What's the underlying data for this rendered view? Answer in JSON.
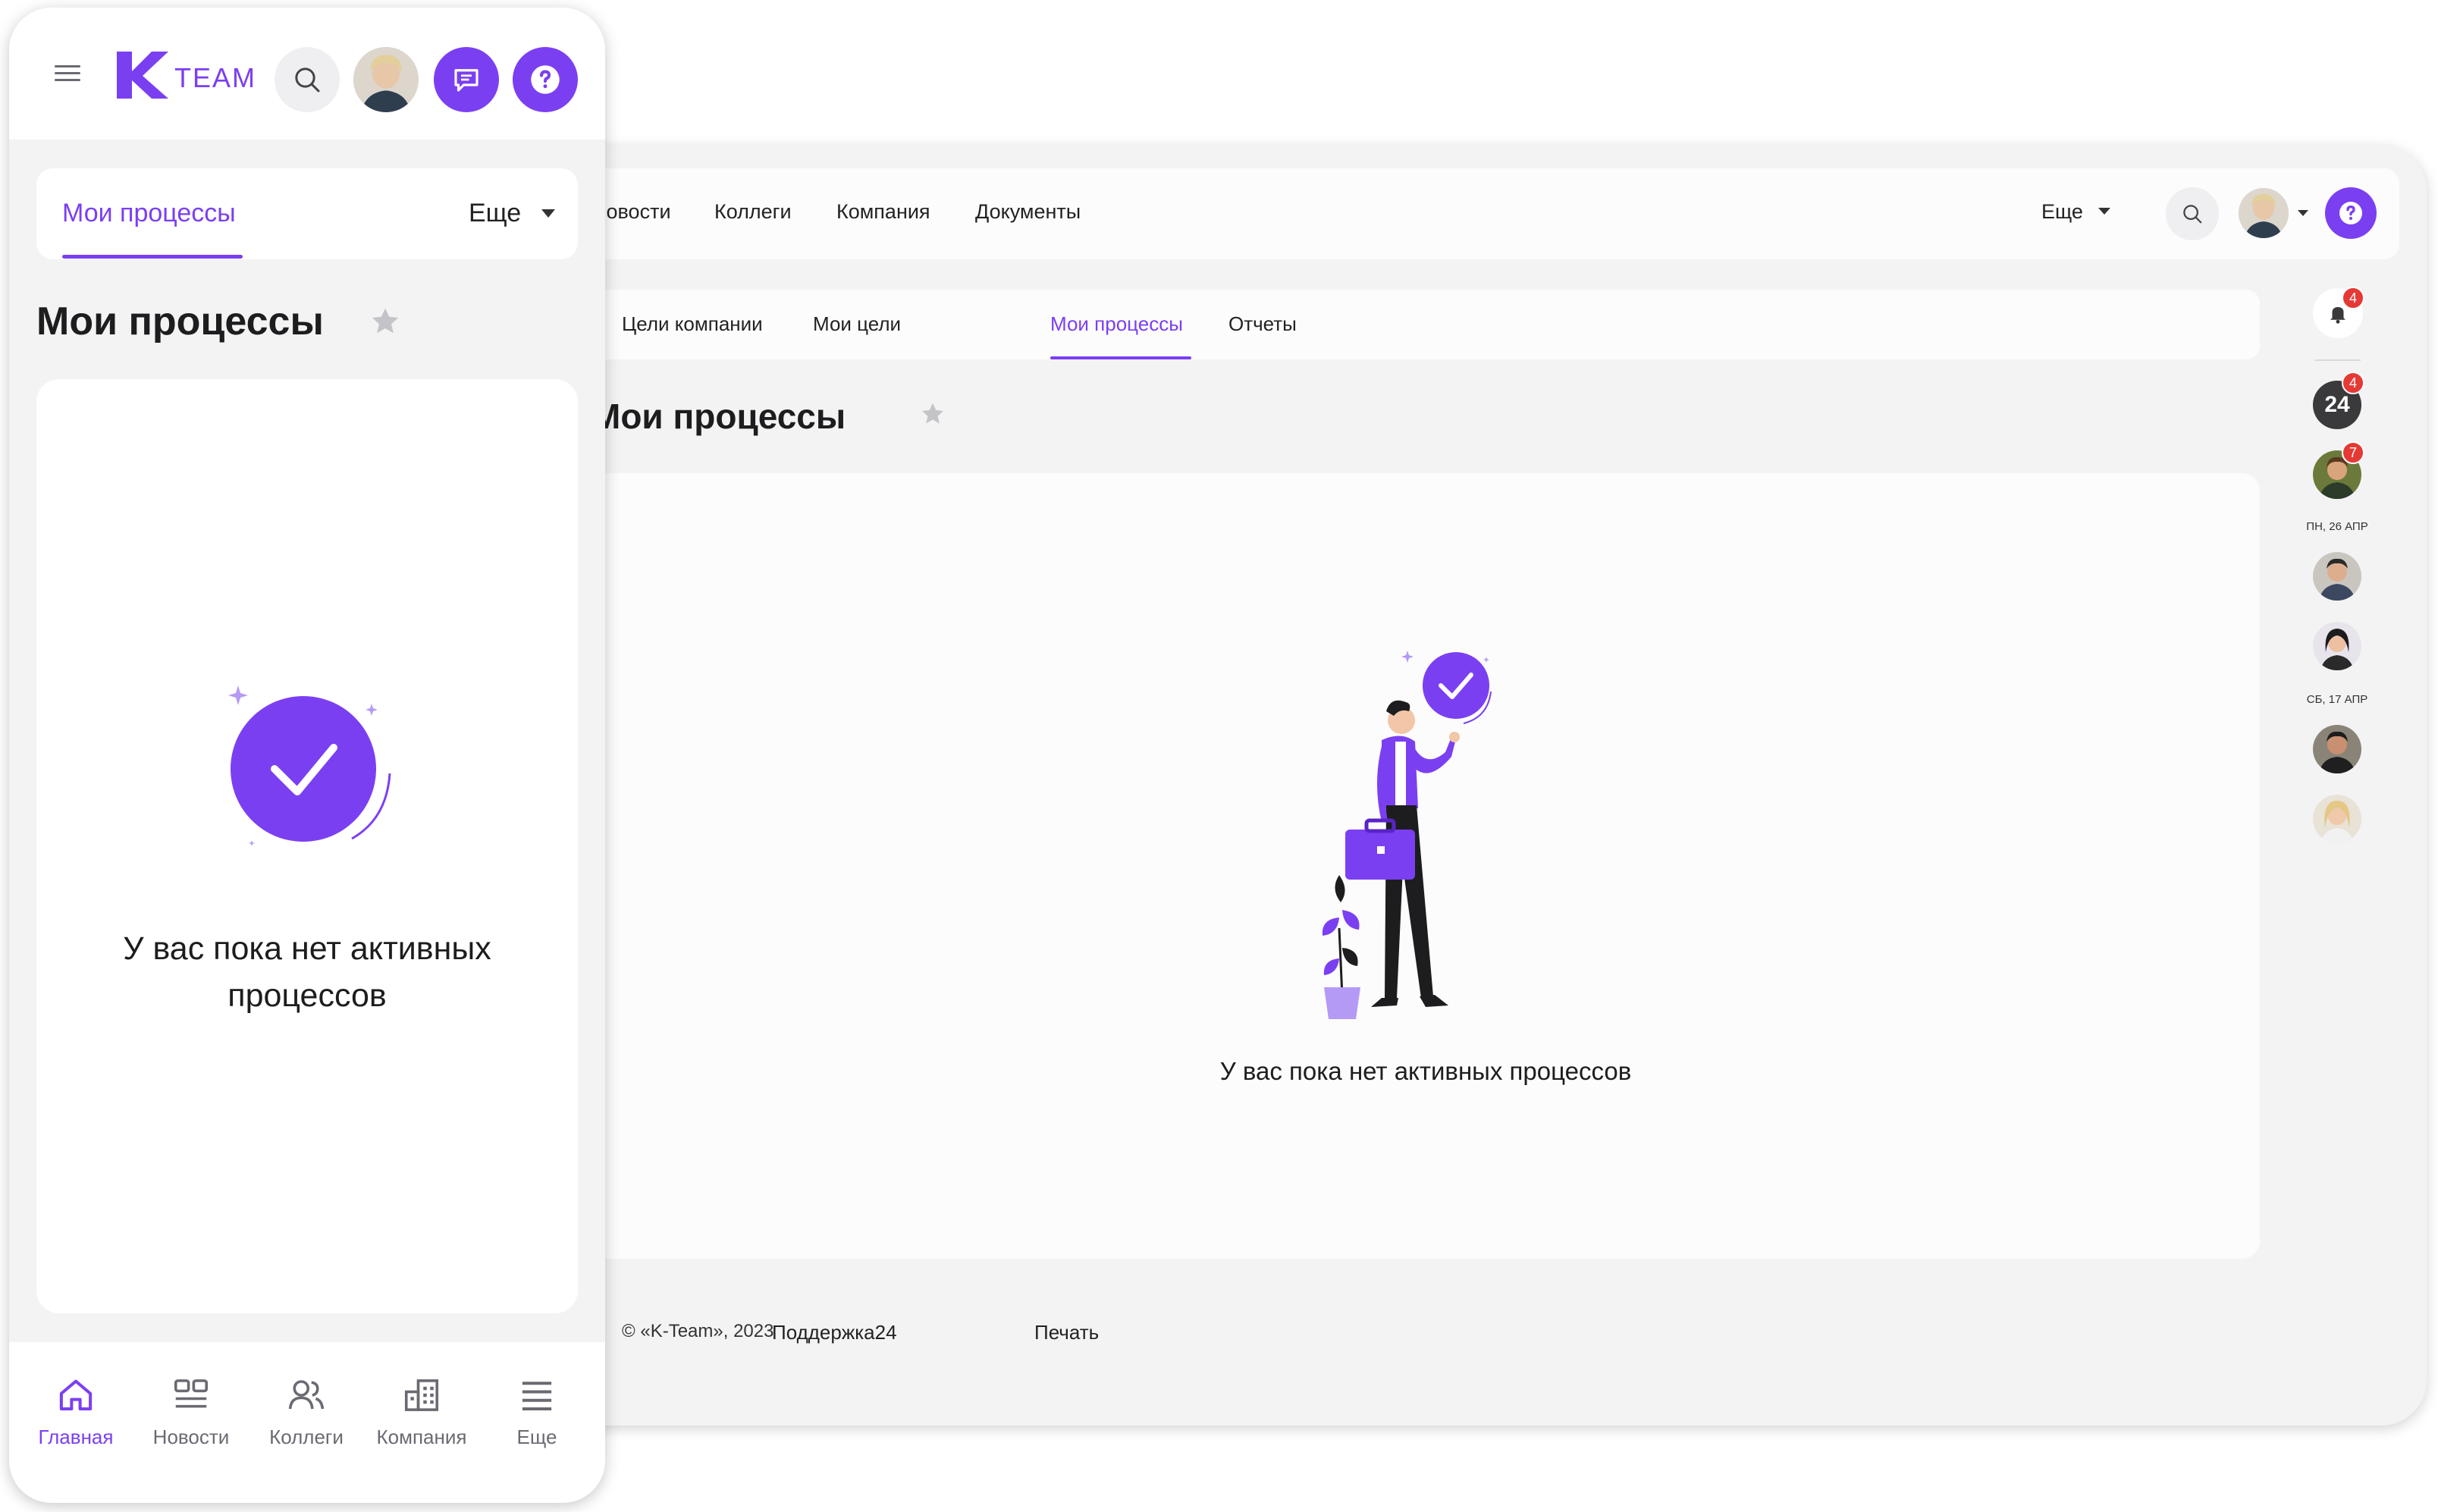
{
  "desktop": {
    "nav": [
      "Новости",
      "Коллеги",
      "Компания",
      "Документы"
    ],
    "more_label": "Еще",
    "tabs": [
      "Цели компании",
      "Мои цели",
      "Мои процессы",
      "Отчеты"
    ],
    "active_tab": "Мои процессы",
    "title": "Мои процессы",
    "empty_text": "У вас пока нет активных процессов",
    "footer": {
      "copyright": "© «K-Team», 2023",
      "support": "Поддержка24",
      "print": "Печать"
    },
    "rail": {
      "bell_badge": "4",
      "b24_label": "24",
      "b24_badge": "4",
      "contact1_badge": "7",
      "date1": "ПН, 26 АПР",
      "date2": "СБ, 17 АПР"
    }
  },
  "mobile": {
    "logo_text": "TEAM",
    "active_tab": "Мои процессы",
    "more_label": "Еще",
    "title": "Мои процессы",
    "empty_text_line1": "У вас пока нет активных",
    "empty_text_line2": "процессов",
    "bottom_nav": [
      {
        "label": "Главная",
        "icon": "home-icon",
        "active": true
      },
      {
        "label": "Новости",
        "icon": "news-icon",
        "active": false
      },
      {
        "label": "Коллеги",
        "icon": "colleagues-icon",
        "active": false
      },
      {
        "label": "Компания",
        "icon": "company-icon",
        "active": false
      },
      {
        "label": "Еще",
        "icon": "menu-icon",
        "active": false
      }
    ]
  },
  "colors": {
    "accent": "#7b3ff2",
    "background": "#f3f3f4",
    "badge": "#e53935"
  }
}
